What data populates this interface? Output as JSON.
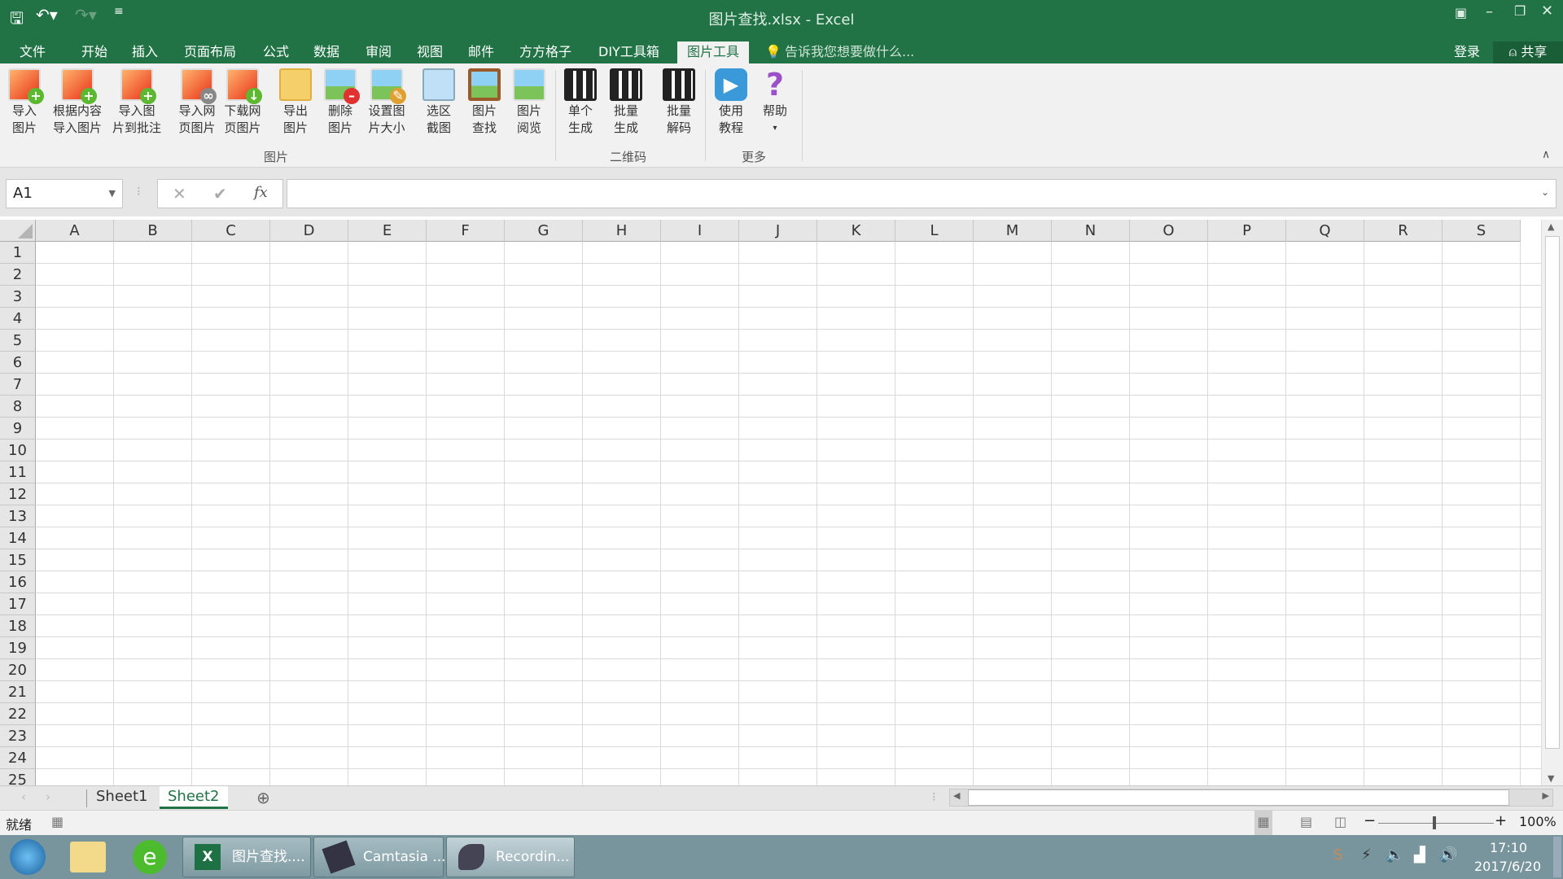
{
  "window": {
    "title": "图片查找.xlsx - Excel",
    "accent": "#217346"
  },
  "qat": {
    "save": "save-icon",
    "undo": "undo-icon",
    "redo": "redo-icon"
  },
  "tabs": [
    {
      "label": "文件"
    },
    {
      "label": "开始"
    },
    {
      "label": "插入"
    },
    {
      "label": "页面布局"
    },
    {
      "label": "公式"
    },
    {
      "label": "数据"
    },
    {
      "label": "审阅"
    },
    {
      "label": "视图"
    },
    {
      "label": "邮件"
    },
    {
      "label": "方方格子"
    },
    {
      "label": "DIY工具箱"
    },
    {
      "label": "图片工具",
      "active": true
    }
  ],
  "tell_me": "告诉我您想要做什么...",
  "login": "登录",
  "share": "共享",
  "ribbon": {
    "buttons": [
      {
        "l1": "导入",
        "l2": "图片"
      },
      {
        "l1": "根据内容",
        "l2": "导入图片"
      },
      {
        "l1": "导入图",
        "l2": "片到批注"
      },
      {
        "l1": "导入网",
        "l2": "页图片"
      },
      {
        "l1": "下载网",
        "l2": "页图片"
      },
      {
        "l1": "导出",
        "l2": "图片"
      },
      {
        "l1": "删除",
        "l2": "图片"
      },
      {
        "l1": "设置图",
        "l2": "片大小"
      },
      {
        "l1": "选区",
        "l2": "截图"
      },
      {
        "l1": "图片",
        "l2": "查找"
      },
      {
        "l1": "图片",
        "l2": "阅览"
      },
      {
        "l1": "单个",
        "l2": "生成"
      },
      {
        "l1": "批量",
        "l2": "生成"
      },
      {
        "l1": "批量",
        "l2": "解码"
      },
      {
        "l1": "使用",
        "l2": "教程"
      },
      {
        "l1": "帮助",
        "l2": ""
      }
    ],
    "groups": [
      "图片",
      "二维码",
      "更多"
    ]
  },
  "formula": {
    "name_box": "A1",
    "fx": "fx",
    "value": ""
  },
  "columns": [
    "A",
    "B",
    "C",
    "D",
    "E",
    "F",
    "G",
    "H",
    "I",
    "J",
    "K",
    "L",
    "M",
    "N",
    "O",
    "P",
    "Q",
    "R",
    "S"
  ],
  "rows": [
    "1",
    "2",
    "3",
    "4",
    "5",
    "6",
    "7",
    "8",
    "9",
    "10",
    "11",
    "12",
    "13",
    "14",
    "15",
    "16",
    "17",
    "18",
    "19",
    "20",
    "21",
    "22",
    "23",
    "24",
    "25"
  ],
  "sheets": [
    {
      "label": "Sheet1"
    },
    {
      "label": "Sheet2",
      "active": true
    }
  ],
  "status": {
    "ready": "就绪",
    "zoom": "100%",
    "zoom_level": 100
  },
  "taskbar": {
    "apps": [
      {
        "label": "图片查找...."
      },
      {
        "label": "Camtasia ..."
      },
      {
        "label": "Recordin..."
      }
    ],
    "time": "17:10",
    "date": "2017/6/20"
  }
}
